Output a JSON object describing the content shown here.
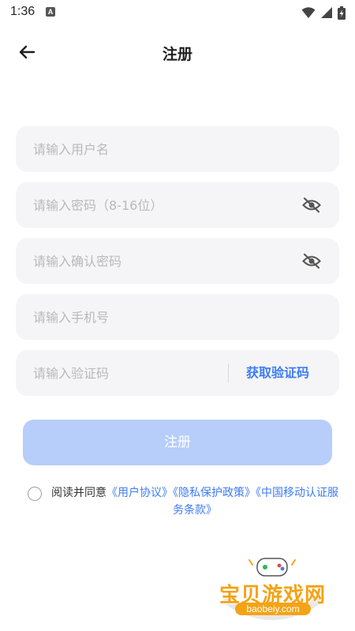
{
  "status_bar": {
    "time": "1:36",
    "notification_letter": "A",
    "icons": [
      "wifi-icon",
      "signal-icon",
      "battery-charging-icon"
    ]
  },
  "app_bar": {
    "back_icon": "arrow-left-icon",
    "title": "注册"
  },
  "form": {
    "username_placeholder": "请输入用户名",
    "password_placeholder": "请输入密码（8-16位）",
    "confirm_password_placeholder": "请输入确认密码",
    "phone_placeholder": "请输入手机号",
    "code_placeholder": "请输入验证码",
    "get_code_label": "获取验证码",
    "password_toggle_icon": "eye-off-icon",
    "confirm_toggle_icon": "eye-off-icon"
  },
  "register_button": {
    "label": "注册"
  },
  "agreement": {
    "prefix": "阅读并同意",
    "user_agreement": "《用户协议》",
    "privacy_policy": "《隐私保护政策》",
    "cmcc_terms": "《中国移动认证服务条款》",
    "checked": false
  },
  "watermark": {
    "title": "宝贝游戏网",
    "url": "baobeiy.com"
  },
  "colors": {
    "accent": "#3d7cf5",
    "button_disabled": "#b7cdfa",
    "field_bg": "#f5f5f7",
    "placeholder": "#b9b9bd",
    "watermark_orange": "#f4a316"
  }
}
